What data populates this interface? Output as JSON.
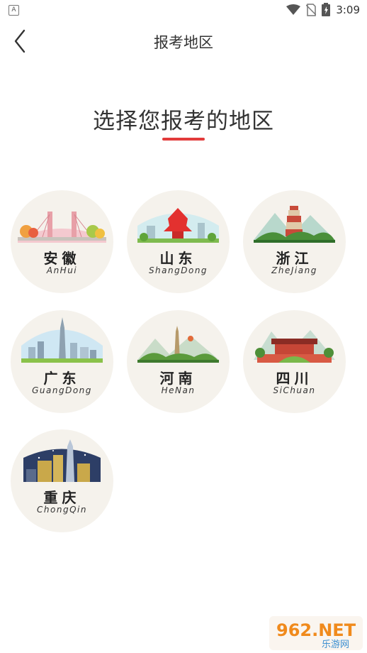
{
  "status_bar": {
    "notification_icon": "a-icon",
    "time": "3:09",
    "icons": [
      "wifi-icon",
      "no-sim-icon",
      "battery-icon"
    ]
  },
  "nav": {
    "title": "报考地区",
    "back_icon": "chevron-left-icon"
  },
  "heading": {
    "text": "选择您报考的地区",
    "accent_color": "#e23b3b"
  },
  "regions": [
    {
      "cn": "安徽",
      "en": "AnHui"
    },
    {
      "cn": "山东",
      "en": "ShangDong"
    },
    {
      "cn": "浙江",
      "en": "ZheJiang"
    },
    {
      "cn": "广东",
      "en": "GuangDong"
    },
    {
      "cn": "河南",
      "en": "HeNan"
    },
    {
      "cn": "四川",
      "en": "SiChuan"
    },
    {
      "cn": "重庆",
      "en": "ChongQin"
    }
  ],
  "watermark": {
    "brand": "962.NET",
    "sub": "乐游网"
  }
}
